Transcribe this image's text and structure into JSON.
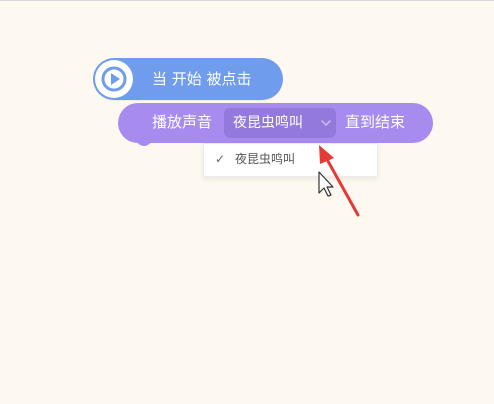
{
  "hat_block": {
    "label": "当 开始 被点击",
    "icon": "play-icon"
  },
  "sound_block": {
    "prefix": "播放声音",
    "selected_sound": "夜昆虫鸣叫",
    "suffix": "直到结束"
  },
  "dropdown": {
    "items": [
      {
        "label": "夜昆虫鸣叫",
        "checked": true,
        "check_mark": "✓"
      }
    ]
  },
  "annotation": {
    "arrow_color": "#e53935"
  },
  "colors": {
    "background": "#fdf9f1",
    "event_block": "#6f9cec",
    "sound_block": "#a88bef",
    "sound_select": "#9479dc"
  }
}
